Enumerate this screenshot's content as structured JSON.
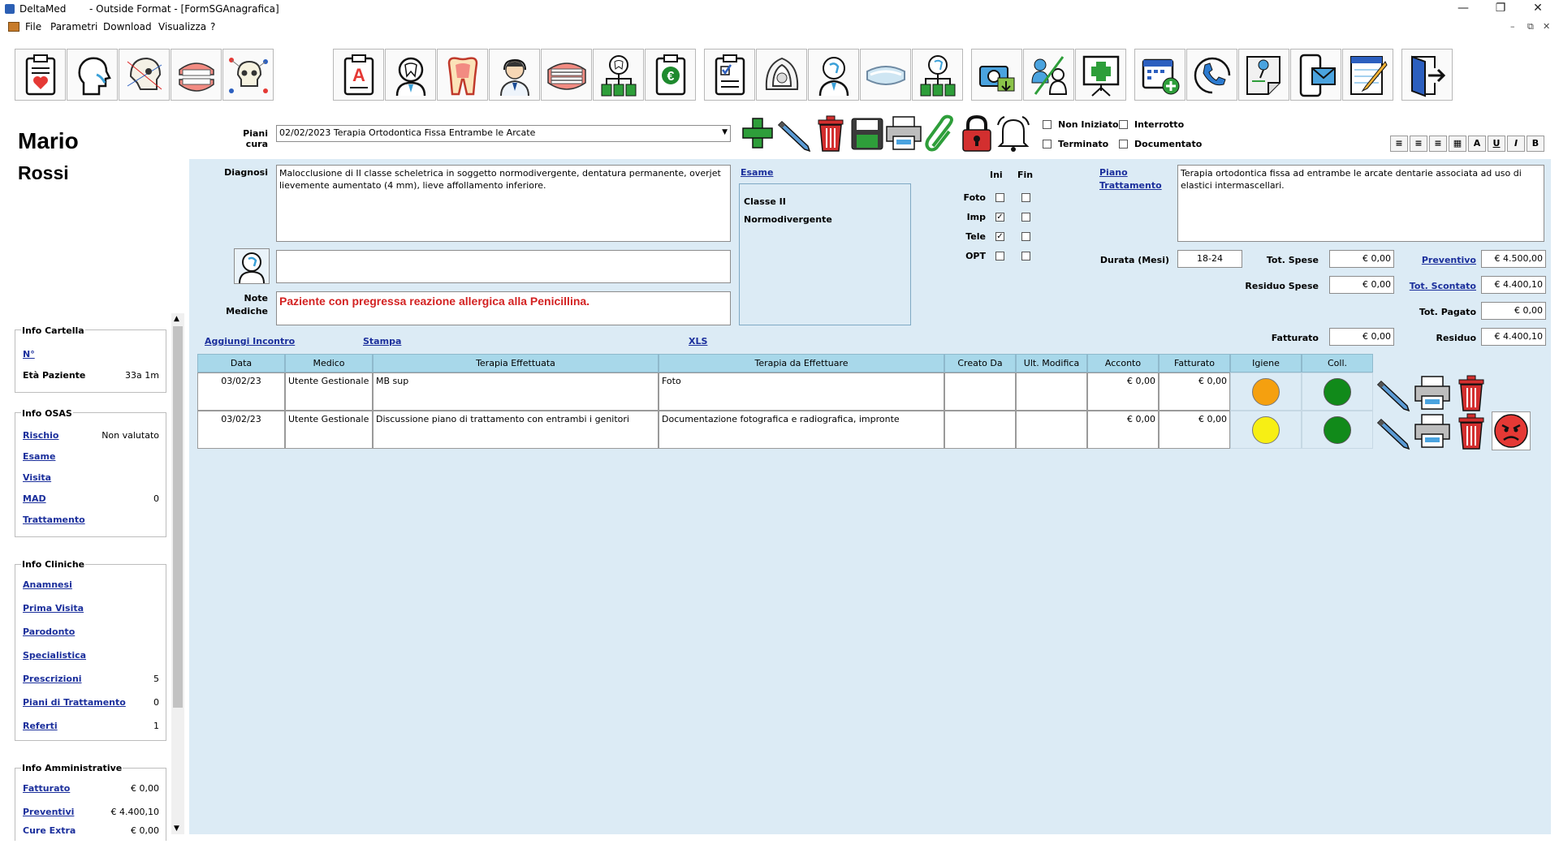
{
  "window": {
    "app_title": "DeltaMed",
    "doc_title": "- Outside Format - [FormSGAnagrafica]"
  },
  "menu": [
    "File",
    "Parametri",
    "Download",
    "Visualizza",
    "?"
  ],
  "toolbar": {
    "group1": [
      "clipboard-heart-icon",
      "head-profile-icon",
      "skull-xray-icon",
      "dentures-icon",
      "skull-network-icon"
    ],
    "group2": [
      "report-a-icon",
      "tooth-doctor-icon",
      "tooth-section-icon",
      "doctor-headset-icon",
      "braces-icon",
      "tooth-network-icon",
      "invoice-euro-icon"
    ],
    "group3": [
      "checklist-icon",
      "mask-icon",
      "head-network-icon",
      "aligner-icon",
      "network-hierarchy-icon"
    ],
    "group4": [
      "camera-folder-icon",
      "users-split-icon",
      "presentation-plus-icon",
      "calendar-add-icon",
      "phone-icon",
      "note-pin-icon",
      "mobile-mail-icon",
      "notepad-pencil-icon",
      "exit-door-icon"
    ]
  },
  "patient": {
    "first_name": "Mario",
    "last_name": "Rossi"
  },
  "info_cartella": {
    "title": "Info Cartella",
    "numero_label": "N°",
    "eta_label": "Età Paziente",
    "eta_value": "33a 1m"
  },
  "info_osas": {
    "title": "Info OSAS",
    "rischio_label": "Rischio",
    "rischio_value": "Non valutato",
    "esame_label": "Esame",
    "visita_label": "Visita",
    "mad_label": "MAD",
    "mad_value": "0",
    "trattamento_label": "Trattamento"
  },
  "info_cliniche": {
    "title": "Info Cliniche",
    "anamnesi": "Anamnesi",
    "prima_visita": "Prima Visita",
    "parodonto": "Parodonto",
    "specialistica": "Specialistica",
    "prescrizioni": "Prescrizioni",
    "prescrizioni_value": "5",
    "piani": "Piani di Trattamento",
    "piani_value": "0",
    "referti": "Referti",
    "referti_value": "1"
  },
  "info_amministrative": {
    "title": "Info Amministrative",
    "fatturato": "Fatturato",
    "fatturato_value": "€ 0,00",
    "preventivi": "Preventivi",
    "preventivi_value": "€ 4.400,10",
    "cure_extra": "Cure Extra",
    "cure_extra_value": "€ 0,00"
  },
  "piani_cura": {
    "label": "Piani cura",
    "selected": "02/02/2023 Terapia Ortodontica Fissa Entrambe le Arcate"
  },
  "status_checks": {
    "non_iniziato": "Non Iniziato",
    "interrotto": "Interrotto",
    "terminato": "Terminato",
    "documentato": "Documentato"
  },
  "format_buttons": [
    "≡",
    "≡",
    "≡",
    "▦",
    "A",
    "U",
    "I",
    "B"
  ],
  "diagnosi": {
    "label": "Diagnosi",
    "text": "Malocclusione di II classe scheletrica in soggetto normodivergente, dentatura permanente, overjet lievemente aumentato (4 mm), lieve affollamento inferiore."
  },
  "note_mediche": {
    "label_line1": "Note",
    "label_line2": "Mediche",
    "text": "Paziente con pregressa reazione allergica alla Penicillina."
  },
  "esame": {
    "label": "Esame",
    "line1": "Classe II",
    "line2": "Normodivergente"
  },
  "imaging": {
    "ini_label": "Ini",
    "fin_label": "Fin",
    "rows": [
      {
        "label": "Foto",
        "ini": false,
        "fin": false
      },
      {
        "label": "Imp",
        "ini": true,
        "fin": false
      },
      {
        "label": "Tele",
        "ini": true,
        "fin": false
      },
      {
        "label": "OPT",
        "ini": false,
        "fin": false
      }
    ]
  },
  "piano_trattamento": {
    "label_line1": "Piano",
    "label_line2": "Trattamento",
    "text": "Terapia ortodontica fissa ad entrambe le arcate dentarie associata ad uso di elastici intermascellari."
  },
  "economics": {
    "durata_label": "Durata (Mesi)",
    "durata_value": "18-24",
    "tot_spese_label": "Tot. Spese",
    "tot_spese_value": "€ 0,00",
    "residuo_spese_label": "Residuo Spese",
    "residuo_spese_value": "€ 0,00",
    "preventivo_label": "Preventivo",
    "preventivo_value": "€ 4.500,00",
    "tot_scontato_label": "Tot. Scontato",
    "tot_scontato_value": "€ 4.400,10",
    "tot_pagato_label": "Tot. Pagato",
    "tot_pagato_value": "€ 0,00",
    "fatturato_label": "Fatturato",
    "fatturato_value": "€ 0,00",
    "residuo_label": "Residuo",
    "residuo_value": "€ 4.400,10"
  },
  "actions": {
    "aggiungi": "Aggiungi Incontro",
    "stampa": "Stampa",
    "xls": "XLS"
  },
  "table": {
    "headers": [
      "Data",
      "Medico",
      "Terapia Effettuata",
      "Terapia da Effettuare",
      "Creato Da",
      "Ult. Modifica",
      "Acconto",
      "Fatturato",
      "Igiene",
      "Coll."
    ],
    "rows": [
      {
        "data": "03/02/23",
        "medico": "Utente Gestionale",
        "effettuata": "MB sup",
        "da_effettuare": "Foto",
        "creato_da": "",
        "ult_modifica": "",
        "acconto": "€ 0,00",
        "fatturato": "€ 0,00",
        "igiene_color": "#f5a00f",
        "coll_color": "#118a1a",
        "has_angry": false
      },
      {
        "data": "03/02/23",
        "medico": "Utente Gestionale",
        "effettuata": "Discussione piano di trattamento con entrambi i genitori",
        "da_effettuare": "Documentazione fotografica e radiografica, impronte",
        "creato_da": "",
        "ult_modifica": "",
        "acconto": "€ 0,00",
        "fatturato": "€ 0,00",
        "igiene_color": "#f7ef14",
        "coll_color": "#118a1a",
        "has_angry": true
      }
    ]
  }
}
